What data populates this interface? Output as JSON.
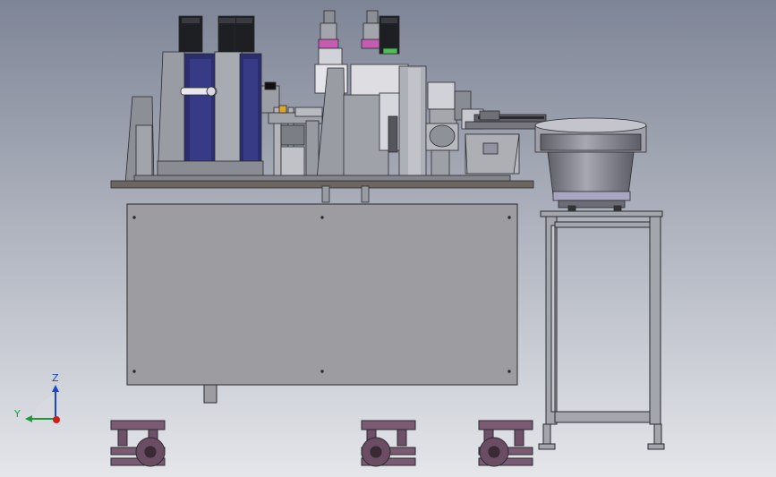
{
  "viewport": {
    "background_top": "#7e8596",
    "background_bottom": "#e4e6ea"
  },
  "triad": {
    "z_label": "Z",
    "y_label": "Y",
    "z_color": "#1a46c8",
    "y_color": "#1e9a3a",
    "x_color": "#d11c1c"
  },
  "colors": {
    "frame_gray": "#8d8f96",
    "dark_navy": "#2c2d6e",
    "motor_black": "#1e1f22",
    "plate_brown": "#6d6660",
    "cabinet_fill": "#9c9ca1",
    "caster_purple": "#7b5b74",
    "bowl_gray": "#8a8b94",
    "purple_tint": "#a8a6be",
    "green_accent": "#4dbf58",
    "pink_accent": "#c45db0"
  }
}
